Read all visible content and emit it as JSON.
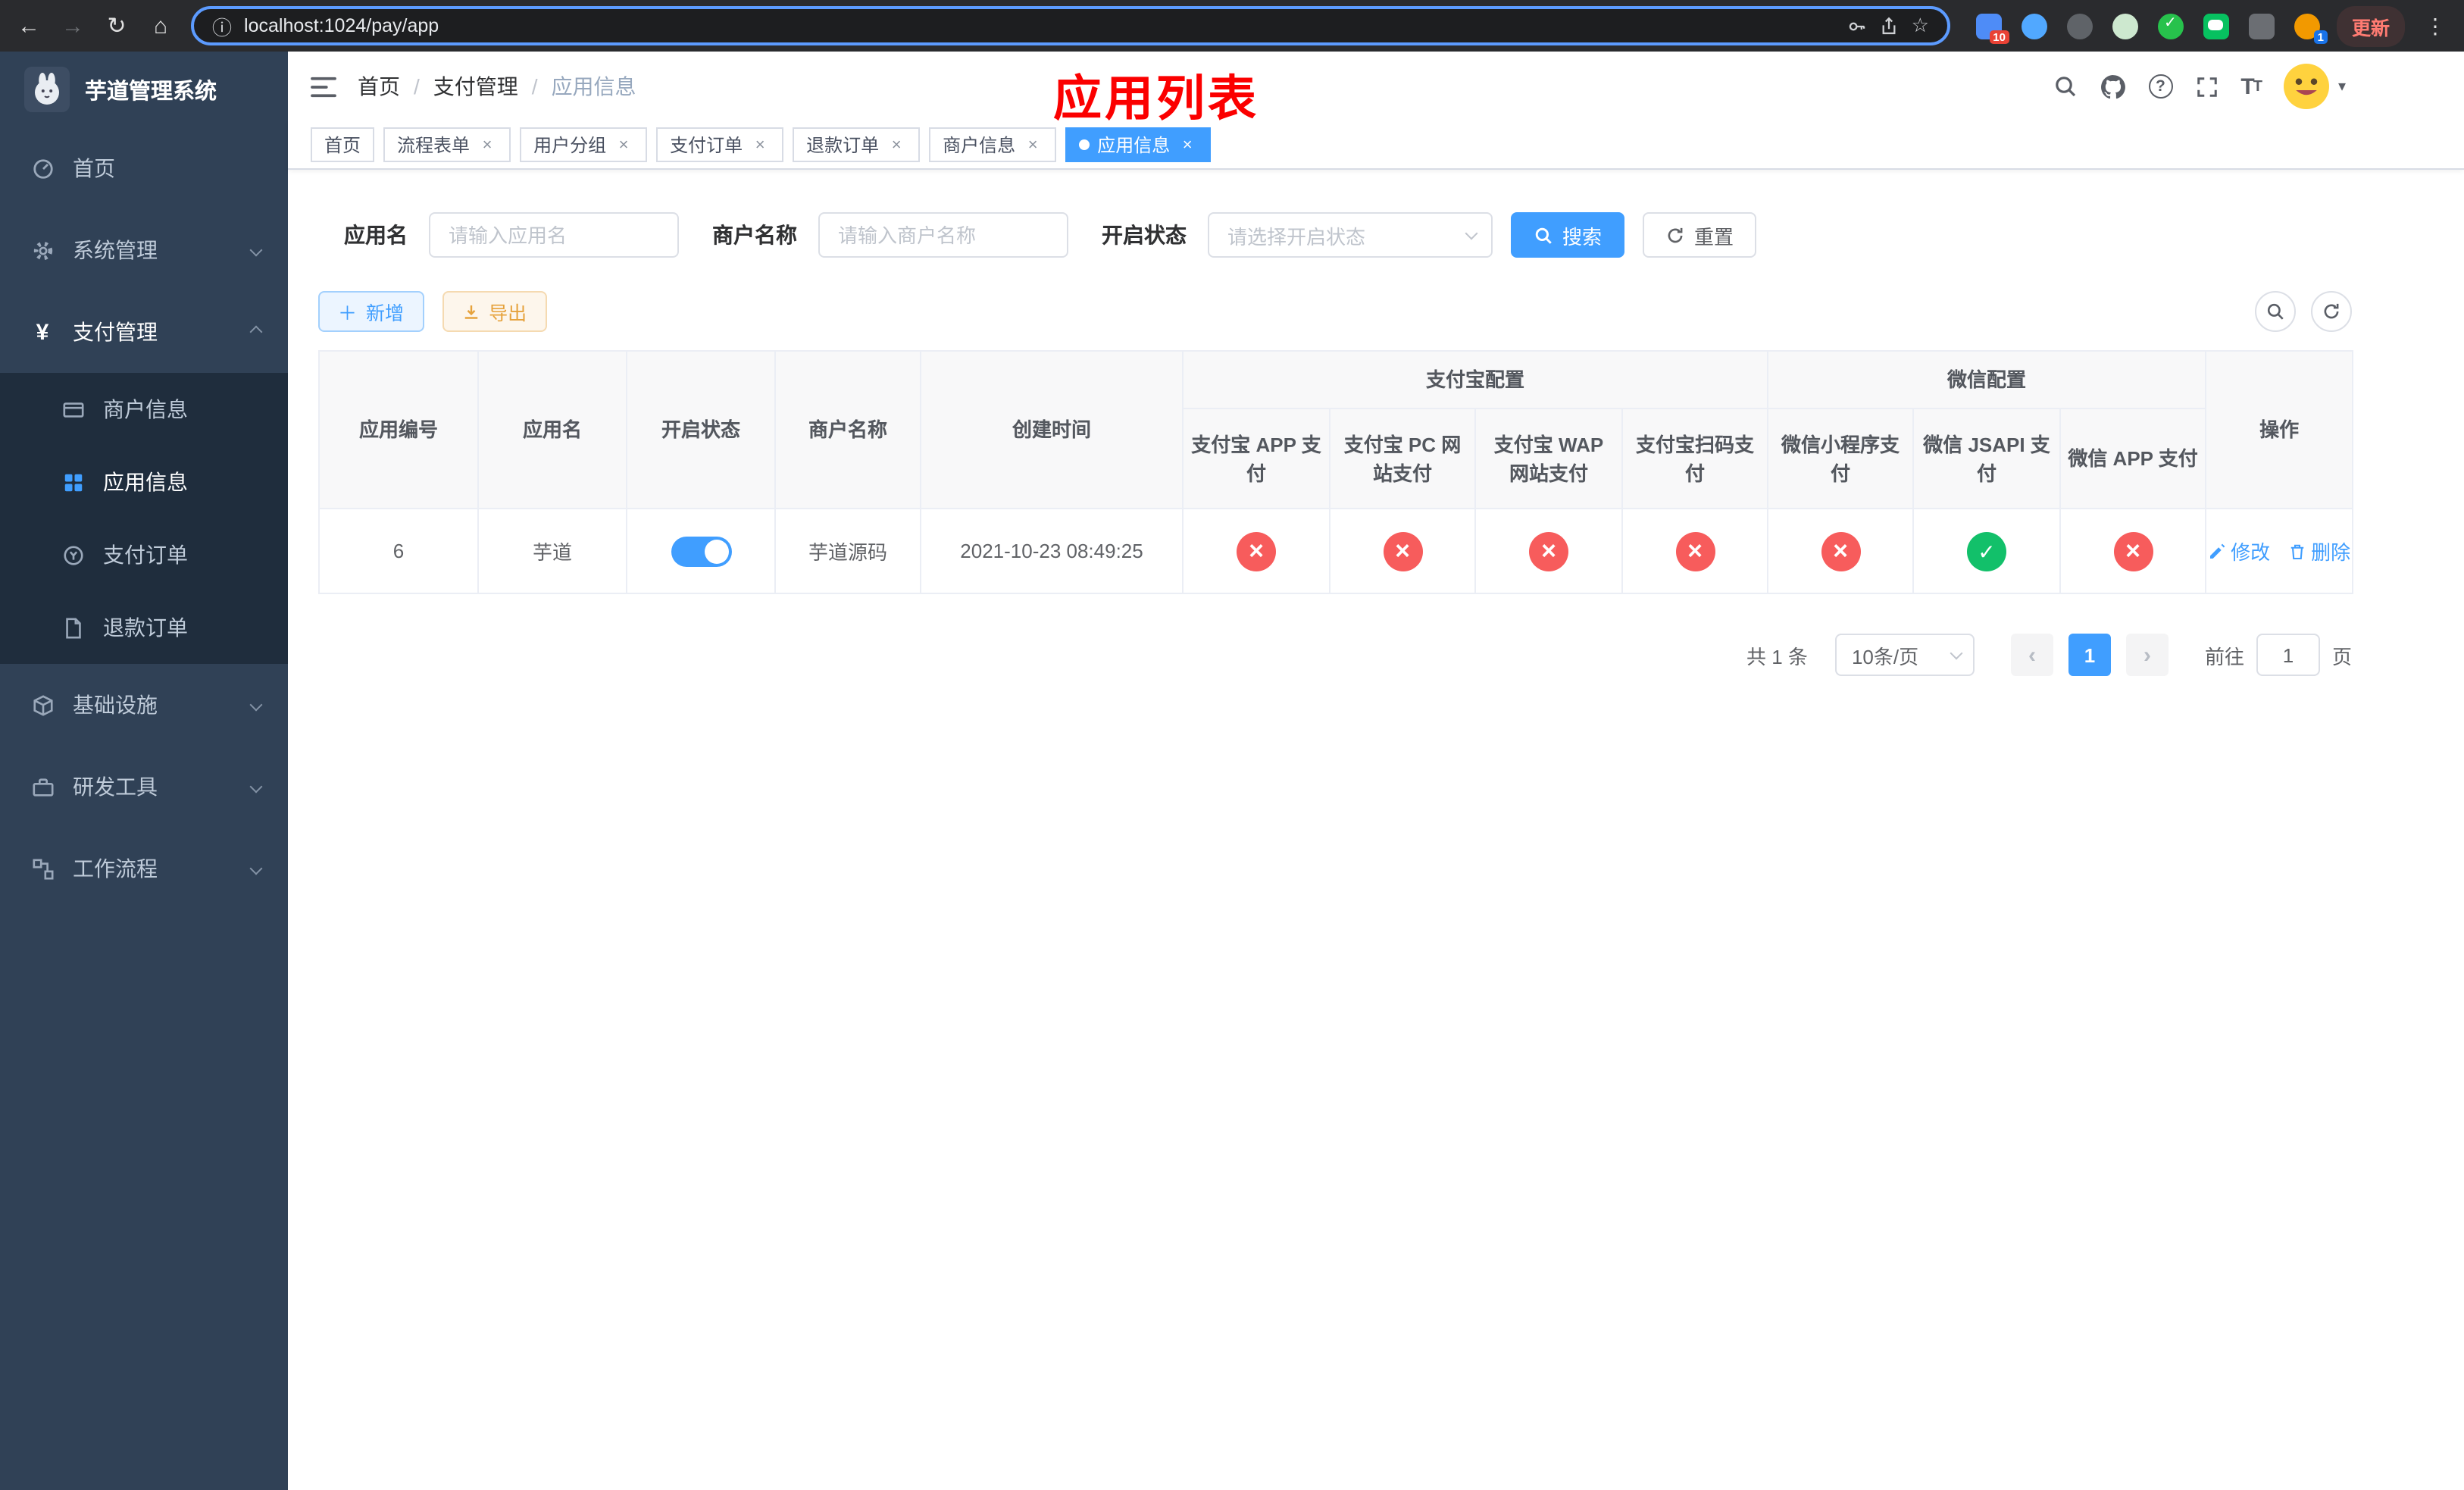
{
  "browser": {
    "url": "localhost:1024/pay/app",
    "update_label": "更新",
    "extension_badge_1": "10",
    "extension_badge_2": "1"
  },
  "sidebar": {
    "app_title": "芋道管理系统",
    "items": {
      "home": "首页",
      "system": "系统管理",
      "payment": "支付管理",
      "merchant": "商户信息",
      "app_info": "应用信息",
      "pay_order": "支付订单",
      "refund_order": "退款订单",
      "infra": "基础设施",
      "dev_tools": "研发工具",
      "workflow": "工作流程"
    }
  },
  "header": {
    "breadcrumb": [
      "首页",
      "支付管理",
      "应用信息"
    ],
    "annotation": "应用列表"
  },
  "tabs": [
    {
      "label": "首页"
    },
    {
      "label": "流程表单"
    },
    {
      "label": "用户分组"
    },
    {
      "label": "支付订单"
    },
    {
      "label": "退款订单"
    },
    {
      "label": "商户信息"
    },
    {
      "label": "应用信息"
    }
  ],
  "filters": {
    "app_name_label": "应用名",
    "app_name_placeholder": "请输入应用名",
    "merchant_label": "商户名称",
    "merchant_placeholder": "请输入商户名称",
    "status_label": "开启状态",
    "status_placeholder": "请选择开启状态",
    "search_label": "搜索",
    "reset_label": "重置"
  },
  "toolbar": {
    "add_label": "新增",
    "export_label": "导出"
  },
  "table": {
    "group_headers": {
      "alipay": "支付宝配置",
      "wechat": "微信配置"
    },
    "columns": [
      "应用编号",
      "应用名",
      "开启状态",
      "商户名称",
      "创建时间",
      "支付宝 APP 支付",
      "支付宝 PC 网站支付",
      "支付宝 WAP 网站支付",
      "支付宝扫码支付",
      "微信小程序支付",
      "微信 JSAPI 支付",
      "微信 APP 支付",
      "操作"
    ],
    "row": {
      "id": "6",
      "name": "芋道",
      "enabled": true,
      "merchant": "芋道源码",
      "created_at": "2021-10-23 08:49:25",
      "pay_channels": [
        false,
        false,
        false,
        false,
        false,
        true,
        false
      ],
      "edit_label": "修改",
      "delete_label": "删除"
    }
  },
  "pagination": {
    "total": "共 1 条",
    "page_size": "10条/页",
    "current_page": "1",
    "goto_label": "前往",
    "goto_value": "1",
    "page_unit": "页"
  }
}
